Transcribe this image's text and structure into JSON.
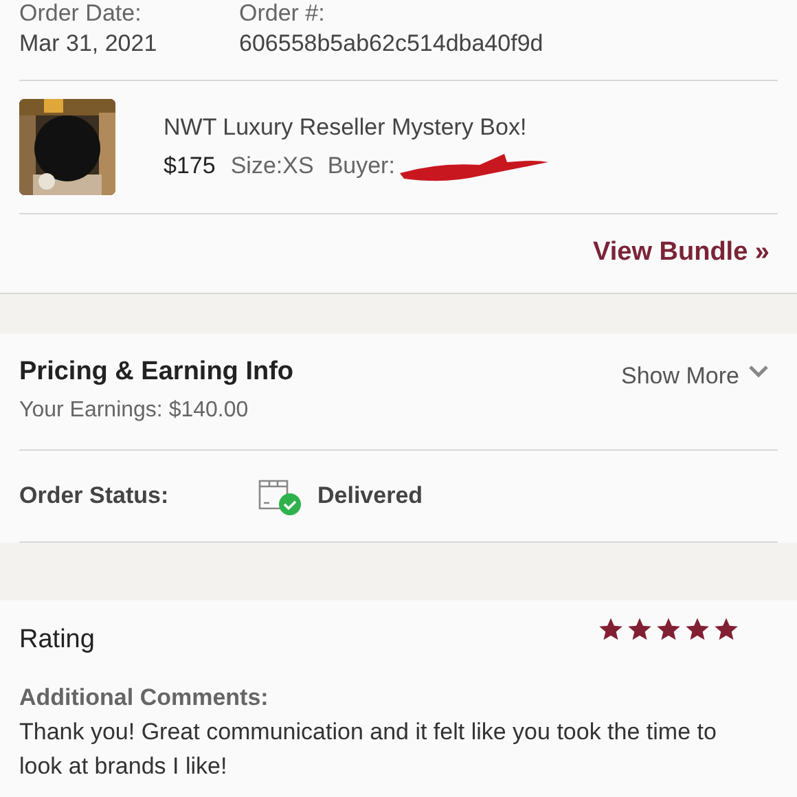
{
  "order": {
    "date_label": "Order Date:",
    "date": "Mar 31, 2021",
    "number_label": "Order #:",
    "number": "606558b5ab62c514dba40f9d"
  },
  "item": {
    "kind": "picture",
    "title": "NWT Luxury Reseller Mystery Box!",
    "price": "$175",
    "size": "Size:XS",
    "buyer_label": "Buyer:"
  },
  "view_bundle": "View Bundle »",
  "pricing": {
    "title": "Pricing & Earning Info",
    "earnings": "Your Earnings: $140.00",
    "toggle": "Show More",
    "expanded": false
  },
  "status": {
    "label": "Order Status:",
    "value": "Delivered",
    "delivered": true
  },
  "rating": {
    "title": "Rating",
    "stars": 5,
    "comments_label": "Additional Comments:",
    "comment": "Thank you! Great communication and it felt like you took the time to look at brands I like!"
  }
}
